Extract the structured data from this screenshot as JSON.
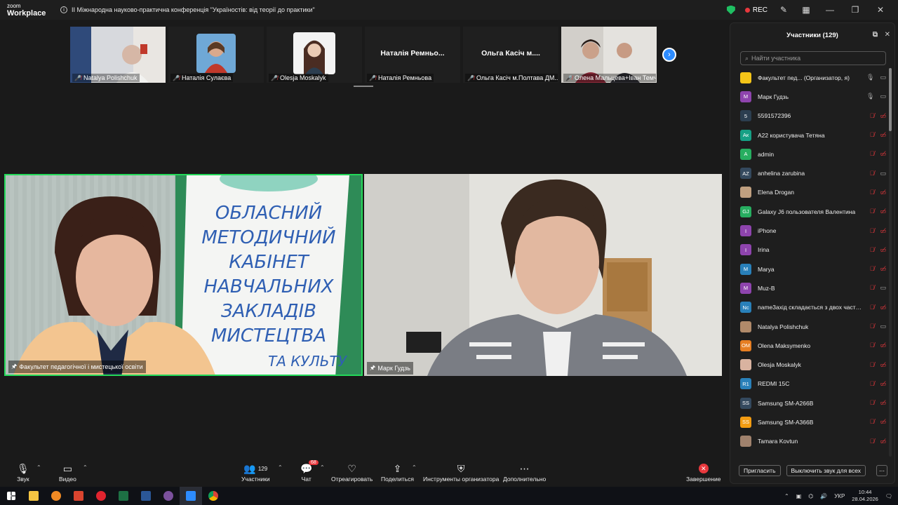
{
  "app": {
    "logo_line1": "zoom",
    "logo_line2": "Workplace"
  },
  "meeting": {
    "title": "II Міжнародна науково-практична конференція \"Україностів: від теорії до практики\""
  },
  "titlebar": {
    "rec_label": "REC"
  },
  "strip": {
    "tiles": [
      {
        "name": "Natalya Polishchuk",
        "kind": "video"
      },
      {
        "name": "Наталія Сулаєва",
        "kind": "photo"
      },
      {
        "name": "Olesja Moskalyk",
        "kind": "photo"
      },
      {
        "name": "Наталія Ремньова",
        "kind": "text",
        "big": "Наталія  Ремньо..."
      },
      {
        "name": "Ольга Касіч м.Полтава ДМ...",
        "kind": "text",
        "big": "Ольга  Касіч  м...."
      },
      {
        "name": "Олена Мальцева+Іван Темч...",
        "kind": "video"
      }
    ],
    "next_icon": "chevron-right-icon"
  },
  "videos": [
    {
      "name": "Факультет педагогічної і мистецької освіти"
    },
    {
      "name": "Марк Гудзь"
    }
  ],
  "toolbar": {
    "audio": "Звук",
    "video": "Видео",
    "participants": "Участники",
    "participants_count": "129",
    "chat": "Чат",
    "chat_badge": "68",
    "react": "Отреагировать",
    "share": "Поделиться",
    "host_tools": "Инструменты организатора",
    "more": "Дополнительно",
    "end": "Завершение"
  },
  "panel": {
    "title": "Участники (129)",
    "search_placeholder": "Найти участника",
    "invite": "Пригласить",
    "mute_all": "Выключить звук для всех",
    "participants": [
      {
        "initials": "",
        "color": "#f5c518",
        "name": "Факультет пед...  (Организатор, я)",
        "mic": "on",
        "cam": "on"
      },
      {
        "initials": "M",
        "color": "#8e44ad",
        "name": "Марк Гудзь",
        "mic": "on",
        "cam": "on"
      },
      {
        "initials": "5",
        "color": "#2c3e50",
        "name": "5591572396",
        "mic": "off",
        "cam": "off"
      },
      {
        "initials": "Ак",
        "color": "#16a085",
        "name": "A22 користувача Тетяна",
        "mic": "off",
        "cam": "off"
      },
      {
        "initials": "A",
        "color": "#27ae60",
        "name": "admin",
        "mic": "off",
        "cam": "off"
      },
      {
        "initials": "AZ",
        "color": "#34495e",
        "name": "anhelina zarubina",
        "mic": "off",
        "cam": "on"
      },
      {
        "initials": "",
        "color": "#c0a080",
        "name": "Elena Drogan",
        "mic": "off",
        "cam": "off"
      },
      {
        "initials": "GJ",
        "color": "#27ae60",
        "name": "Galaxy J6 пользователя Валентина",
        "mic": "off",
        "cam": "off"
      },
      {
        "initials": "I",
        "color": "#8e44ad",
        "name": "iPhone",
        "mic": "off",
        "cam": "off"
      },
      {
        "initials": "I",
        "color": "#8e44ad",
        "name": "Irina",
        "mic": "off",
        "cam": "off"
      },
      {
        "initials": "M",
        "color": "#2980b9",
        "name": "Marya",
        "mic": "off",
        "cam": "off"
      },
      {
        "initials": "M",
        "color": "#8e44ad",
        "name": "Muz-B",
        "mic": "off",
        "cam": "on"
      },
      {
        "initials": "Nc",
        "color": "#2980b9",
        "name": "name3ахід складається з двох части...",
        "mic": "off",
        "cam": "off"
      },
      {
        "initials": "",
        "color": "#b08a6a",
        "name": "Natalya Polishchuk",
        "mic": "off",
        "cam": "on"
      },
      {
        "initials": "OM",
        "color": "#e67e22",
        "name": "Olena Maksymenko",
        "mic": "off",
        "cam": "off"
      },
      {
        "initials": "",
        "color": "#d9b3a0",
        "name": "Olesja Moskalyk",
        "mic": "off",
        "cam": "off"
      },
      {
        "initials": "R1",
        "color": "#2980b9",
        "name": "REDMI 15C",
        "mic": "off",
        "cam": "off"
      },
      {
        "initials": "SS",
        "color": "#34495e",
        "name": "Samsung SM-A266B",
        "mic": "off",
        "cam": "off"
      },
      {
        "initials": "SS",
        "color": "#f39c12",
        "name": "Samsung SM-A366B",
        "mic": "off",
        "cam": "off"
      },
      {
        "initials": "",
        "color": "#a0826d",
        "name": "Tamara Kovtun",
        "mic": "off",
        "cam": "off"
      }
    ]
  },
  "taskbar": {
    "lang": "УКР",
    "time": "10:44",
    "date": "28.04.2026"
  },
  "colors": {
    "active_speaker": "#23d959",
    "accent": "#2d8cff",
    "danger": "#e8383d"
  }
}
